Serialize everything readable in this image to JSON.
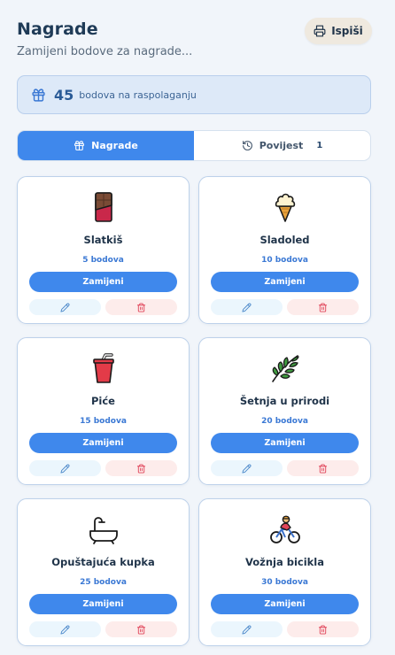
{
  "header": {
    "title": "Nagrade",
    "subtitle": "Zamijeni bodove za nagrade...",
    "print_label": "Ispiši"
  },
  "points": {
    "value": "45",
    "label": "bodova na raspolaganju"
  },
  "tabs": [
    {
      "label": "Nagrade",
      "active": true
    },
    {
      "label": "Povijest",
      "count": "1",
      "active": false
    }
  ],
  "rewards": [
    {
      "name": "Slatkiš",
      "cost": "5 bodova",
      "icon": "chocolate-bar-icon",
      "redeem_label": "Zamijeni"
    },
    {
      "name": "Sladoled",
      "cost": "10 bodova",
      "icon": "ice-cream-icon",
      "redeem_label": "Zamijeni"
    },
    {
      "name": "Piće",
      "cost": "15 bodova",
      "icon": "cup-with-straw-icon",
      "redeem_label": "Zamijeni"
    },
    {
      "name": "Šetnja u prirodi",
      "cost": "20 bodova",
      "icon": "herb-leaf-icon",
      "redeem_label": "Zamijeni"
    },
    {
      "name": "Opuštajuća kupka",
      "cost": "25 bodova",
      "icon": "bathtub-icon",
      "redeem_label": "Zamijeni"
    },
    {
      "name": "Vožnja bicikla",
      "cost": "30 bodova",
      "icon": "person-biking-icon",
      "redeem_label": "Zamijeni"
    }
  ],
  "colors": {
    "accent": "#3f88ec",
    "background": "#f1f5fa",
    "delete": "#e0455a",
    "edit": "#4a87c9"
  }
}
